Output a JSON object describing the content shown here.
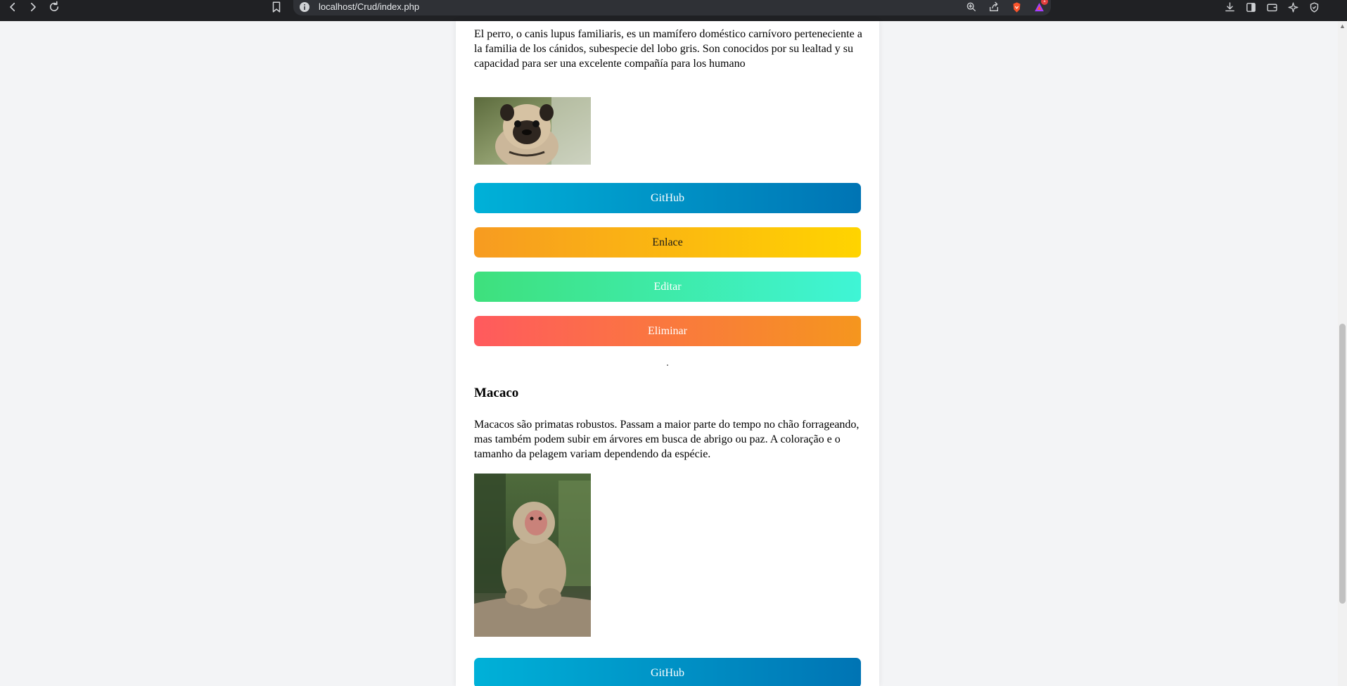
{
  "browser": {
    "url": "localhost/Crud/index.php"
  },
  "dog": {
    "description": "El perro, o canis lupus familiaris, es un mamífero doméstico carnívoro perteneciente a la familia de los cánidos, subespecie del lobo gris. Son conocidos por su lealtad y su capacidad para ser una excelente compañía para los humano",
    "buttons": {
      "github": "GitHub",
      "enlace": "Enlace",
      "editar": "Editar",
      "eliminar": "Eliminar"
    }
  },
  "monkey": {
    "title": "Macaco",
    "description": "Macacos são primatas robustos. Passam a maior parte do tempo no chão forrageando, mas também podem subir em árvores em busca de abrigo ou paz. A coloração e o tamanho da pelagem variam dependendo da espécie.",
    "buttons": {
      "github": "GitHub"
    }
  },
  "colors": {
    "github_gradient": [
      "#00b1d8",
      "#0074b4"
    ],
    "enlace_gradient": [
      "#f79b21",
      "#ffd400"
    ],
    "editar_gradient": [
      "#3ee07c",
      "#3ff5d6"
    ],
    "eliminar_gradient": [
      "#ff5a5e",
      "#f5961e"
    ]
  },
  "icons": [
    "back-icon",
    "forward-icon",
    "reload-icon",
    "bookmark-icon",
    "info-icon",
    "zoom-icon",
    "share-icon",
    "brave-shield-icon",
    "brave-rewards-icon",
    "download-icon",
    "sidebar-icon",
    "wallet-icon",
    "leo-ai-icon",
    "vpn-icon"
  ]
}
